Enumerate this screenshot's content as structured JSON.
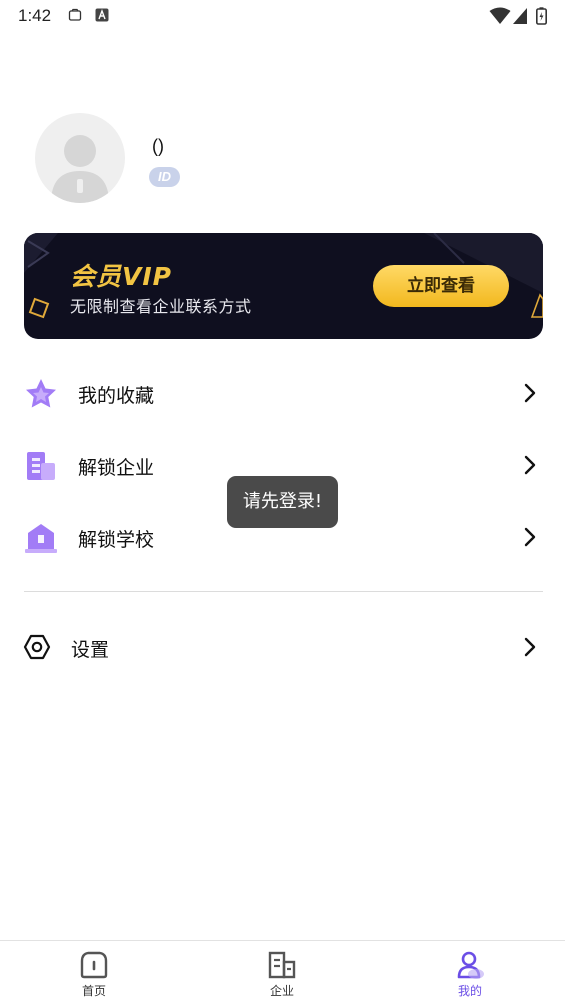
{
  "status_bar": {
    "time": "1:42"
  },
  "profile": {
    "username": "()",
    "id_badge": "ID"
  },
  "vip_card": {
    "title": "会员VIP",
    "subtitle": "无限制查看企业联系方式",
    "button_label": "立即查看"
  },
  "menu": [
    {
      "label": "我的收藏",
      "icon": "star-icon"
    },
    {
      "label": "解锁企业",
      "icon": "building-icon"
    },
    {
      "label": "解锁学校",
      "icon": "school-icon"
    }
  ],
  "settings": {
    "label": "设置",
    "icon": "hexagon-settings-icon"
  },
  "toast": {
    "message": "请先登录!"
  },
  "tab_bar": {
    "tabs": [
      {
        "label": "首页",
        "icon": "home-icon",
        "active": false
      },
      {
        "label": "企业",
        "icon": "company-icon",
        "active": false
      },
      {
        "label": "我的",
        "icon": "profile-icon",
        "active": true
      }
    ]
  },
  "colors": {
    "accent": "#6b4ee6",
    "vip_gold": "#f2c443",
    "vip_bg": "#0f0f1f",
    "menu_icon_purple": "#9b6ff2"
  }
}
